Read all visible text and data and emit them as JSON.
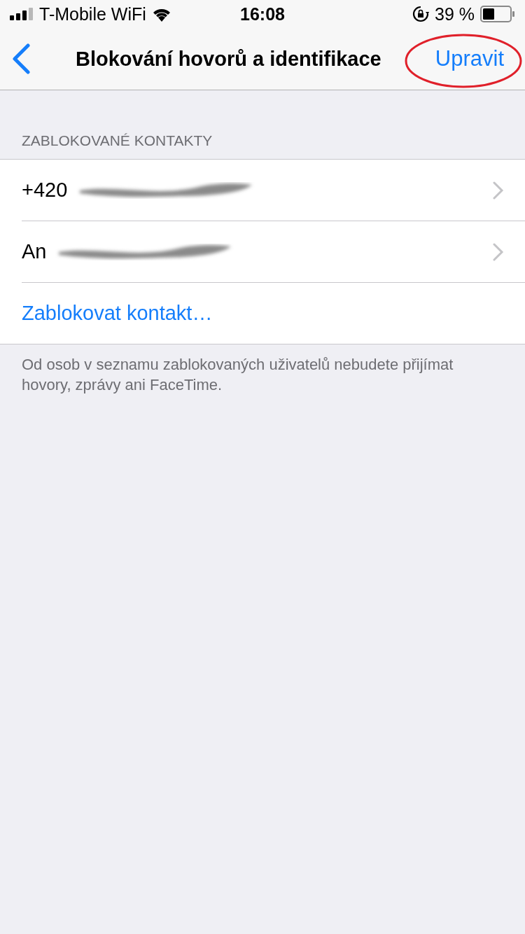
{
  "status_bar": {
    "carrier": "T-Mobile WiFi",
    "time": "16:08",
    "battery": "39 %"
  },
  "nav": {
    "title": "Blokování hovorů a identifikace",
    "action": "Upravit"
  },
  "section": {
    "header": "ZABLOKOVANÉ KONTAKTY",
    "contacts": [
      {
        "label": "+420",
        "kind": "redacted"
      },
      {
        "label": "An",
        "kind": "redacted"
      }
    ],
    "add_action": "Zablokovat kontakt…",
    "footer": "Od osob v seznamu zablokovaných uživatelů nebudete přijímat hovory, zprávy ani FaceTime."
  }
}
